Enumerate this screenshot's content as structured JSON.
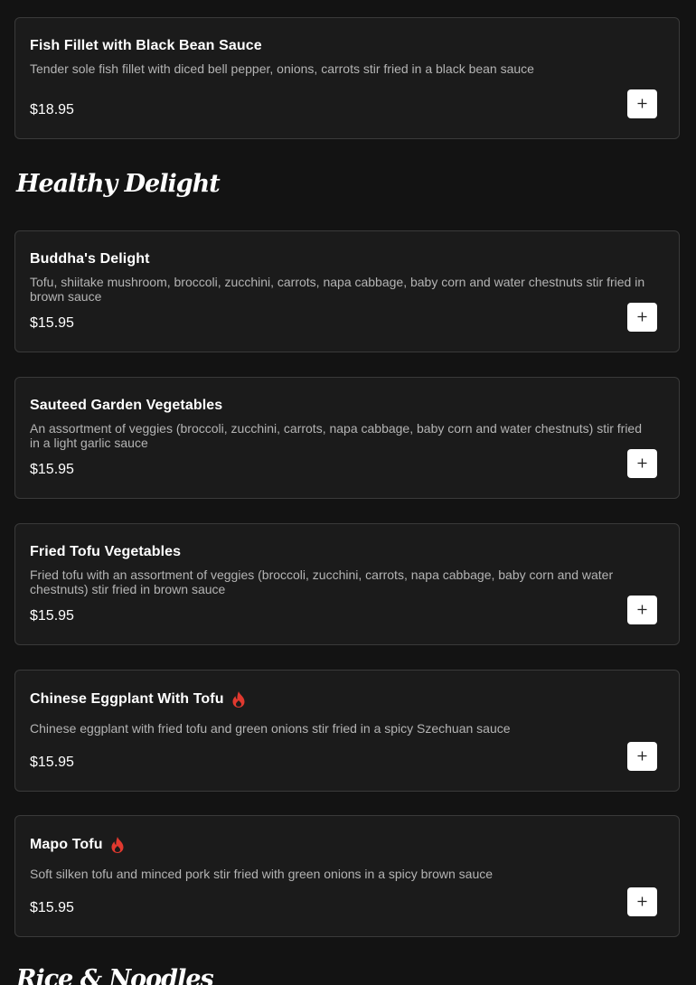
{
  "sections": {
    "healthy": "Healthy Delight",
    "rice": "Rice & Noodles"
  },
  "items": [
    {
      "name": "Fish Fillet with Black Bean Sauce",
      "description": "Tender sole fish fillet with diced bell pepper, onions, carrots stir fried in a black bean sauce",
      "price": "$18.95"
    },
    {
      "name": "Buddha's Delight",
      "description": "Tofu, shiitake mushroom, broccoli, zucchini, carrots, napa cabbage, baby corn and water chestnuts stir fried in brown sauce",
      "price": "$15.95"
    },
    {
      "name": "Sauteed Garden Vegetables",
      "description": "An assortment of veggies (broccoli, zucchini, carrots, napa cabbage, baby corn and water chestnuts) stir fried in a light garlic sauce",
      "price": "$15.95"
    },
    {
      "name": "Fried Tofu Vegetables",
      "description": "Fried tofu with an assortment of veggies (broccoli, zucchini, carrots, napa cabbage, baby corn and water chestnuts) stir fried in brown sauce",
      "price": "$15.95"
    },
    {
      "name": "Chinese Eggplant With Tofu",
      "description": "Chinese eggplant with fried tofu and green onions stir fried in a spicy Szechuan sauce",
      "price": "$15.95",
      "spicy_icon": "flame-icon"
    },
    {
      "name": "Mapo Tofu",
      "description": "Soft silken tofu and minced pork stir fried with green onions in a spicy brown sauce",
      "price": "$15.95",
      "spicy_icon": "flame-icon"
    }
  ],
  "add_icon": "plus-icon",
  "colors": {
    "background": "#131313",
    "card": "#1b1b1b",
    "card_border": "#3a3a3a",
    "description": "#b4b4b4",
    "spicy": "#e0392f",
    "add_button": "#ffffff"
  }
}
